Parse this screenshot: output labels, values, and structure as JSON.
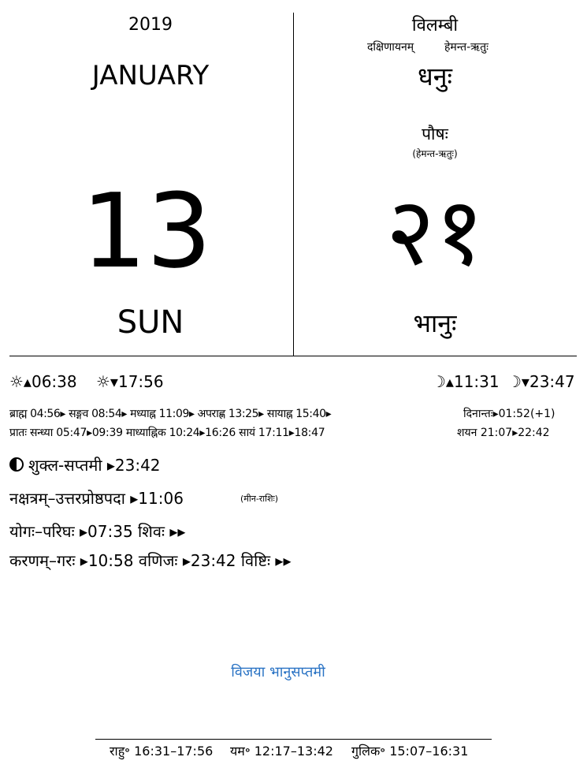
{
  "left": {
    "year": "2019",
    "month": "JANUARY",
    "day": "13",
    "weekday": "SUN"
  },
  "right": {
    "samvatsara": "विलम्बी",
    "ayana": "दक्षिणायनम्",
    "ritu": "हेमन्त-ऋतुः",
    "solar_month": "धनुः",
    "lunar_month": "पौषः",
    "lunar_ritu": "(हेमन्त-ऋतुः)",
    "day": "२१",
    "weekday": "भानुः"
  },
  "sun": {
    "rise": "☼▴06:38",
    "set": "☼▾17:56"
  },
  "moon": {
    "rise": "☽▴11:31",
    "set": "☽▾23:47"
  },
  "muhurta_line1": "ब्राह्म 04:56▸ सङ्गव 08:54▸ मध्याह्न 11:09▸ अपराह्ण 13:25▸ सायाह्न 15:40▸",
  "dinanta": "दिनान्तः▸01:52(+1)",
  "muhurta_line2": "प्रातः सन्ध्या 05:47▸09:39 माध्याह्निक 10:24▸16:26 सायं 17:11▸18:47",
  "shayana": "शयन 21:07▸22:42",
  "tithi": "शुक्ल-सप्तमी ▸23:42",
  "tithi_icon": "half-moon-icon",
  "nakshatra": "नक्षत्रम्–उत्तरप्रोष्ठपदा ▸11:06",
  "rashi": "(मीन-राशिः)",
  "yoga": "योगः–परिघः ▸07:35  शिवः ▸▸",
  "karana": "करणम्–गरः ▸10:58  वणिजः ▸23:42  विष्टिः ▸▸",
  "festival": "विजया भानुसप्तमी",
  "festival_color": "#2a73c4",
  "footer": {
    "rahu": "राहु॰ 16:31–17:56",
    "yama": "यम॰ 12:17–13:42",
    "gulika": "गुलिक॰ 15:07–16:31"
  }
}
